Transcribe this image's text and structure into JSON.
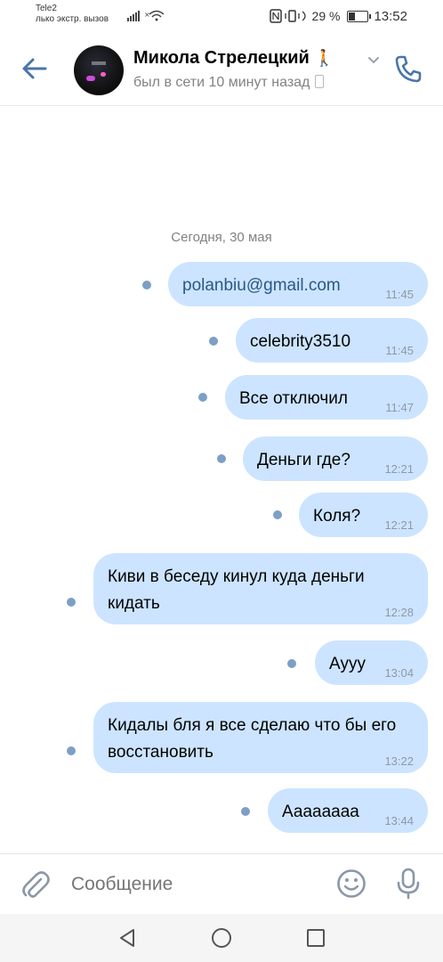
{
  "status_bar": {
    "carrier": "Tele2",
    "carrier_sub": "лько экстр. вызов",
    "battery": "29 %",
    "battery_level": 0.29,
    "time": "13:52"
  },
  "header": {
    "back_icon": "arrow-left-icon",
    "contact_name": "Микола Стрелецкий",
    "name_emoji": "🚶",
    "last_seen": "был в сети 10 минут назад",
    "call_icon": "phone-icon",
    "accent": "#4a76a8"
  },
  "chat": {
    "date_divider": "Сегодня, 30 мая",
    "bubble_color": "#cce4ff",
    "messages": [
      {
        "text": "polanbiu@gmail.com",
        "time": "11:45",
        "is_link": true
      },
      {
        "text": "celebrity3510",
        "time": "11:45"
      },
      {
        "text": "Все отключил",
        "time": "11:47"
      },
      {
        "text": "Деньги где?",
        "time": "12:21"
      },
      {
        "text": "Коля?",
        "time": "12:21"
      },
      {
        "text": "Киви в беседу кинул куда деньги кидать",
        "time": "12:28"
      },
      {
        "text": "Аууу",
        "time": "13:04"
      },
      {
        "text": "Кидалы бля я все сделаю что бы его восстановить",
        "time": "13:22"
      },
      {
        "text": "Ааааааaa",
        "time": "13:44"
      }
    ]
  },
  "composer": {
    "placeholder": "Сообщение",
    "attach_icon": "paperclip-icon",
    "emoji_icon": "smile-icon",
    "mic_icon": "microphone-icon"
  },
  "nav": {
    "back_icon": "triangle-back-icon",
    "home_icon": "circle-home-icon",
    "recent_icon": "square-recent-icon"
  }
}
